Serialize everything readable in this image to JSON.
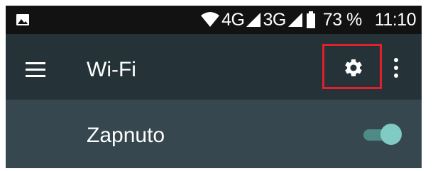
{
  "status_bar": {
    "network_4g": "4G",
    "network_3g": "3G",
    "battery": "73 %",
    "time": "11:10",
    "icons": [
      "image-icon",
      "wifi-icon",
      "signal-icon",
      "battery-icon"
    ]
  },
  "app_bar": {
    "title": "Wi-Fi",
    "menu_icon": "menu-icon",
    "settings_icon": "gear-icon",
    "more_icon": "more-vert-icon",
    "highlight_color": "#e0202a"
  },
  "wifi_toggle": {
    "label": "Zapnuto",
    "state": "on",
    "accent": "#80cbc4"
  },
  "colors": {
    "status_bar": "#121212",
    "app_bar": "#253338",
    "toggle_row": "#37474f"
  }
}
